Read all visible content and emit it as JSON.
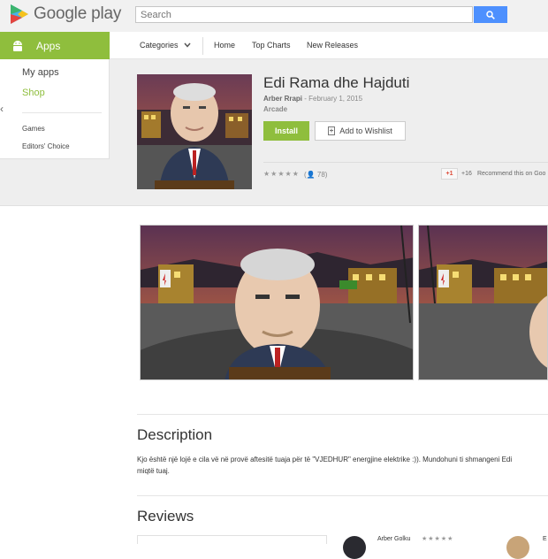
{
  "brand": {
    "name": "Google play"
  },
  "search": {
    "placeholder": "Search"
  },
  "nav": {
    "apps_label": "Apps",
    "categories": "Categories",
    "home": "Home",
    "top_charts": "Top Charts",
    "new_releases": "New Releases"
  },
  "sidebar": {
    "my_apps": "My apps",
    "shop": "Shop",
    "games": "Games",
    "editors_choice": "Editors' Choice"
  },
  "app": {
    "title": "Edi Rama dhe Hajduti",
    "author": "Arber Rrapi",
    "date": "February 1, 2015",
    "category": "Arcade",
    "install_label": "Install",
    "wishlist_label": "Add to Wishlist",
    "rating_count": "78",
    "stars": "★★★★★",
    "gplus_label": "+1",
    "gplus_count": "+16",
    "gplus_recommend": "Recommend this on Goo"
  },
  "description": {
    "title": "Description",
    "text": "Kjo është një lojë e cila vë në provë aftesitë tuaja për të \"VJEDHUR\" energjine elektrike :)). Mundohuni ti shmangeni Edi",
    "text2": "miqtë tuaj."
  },
  "reviews": {
    "title": "Reviews",
    "reviewer1": "Arber Golku",
    "reviewer2": "E",
    "stars": "★★★★★"
  },
  "colors": {
    "accent": "#8fbe3d",
    "search_button": "#4d90fe"
  }
}
